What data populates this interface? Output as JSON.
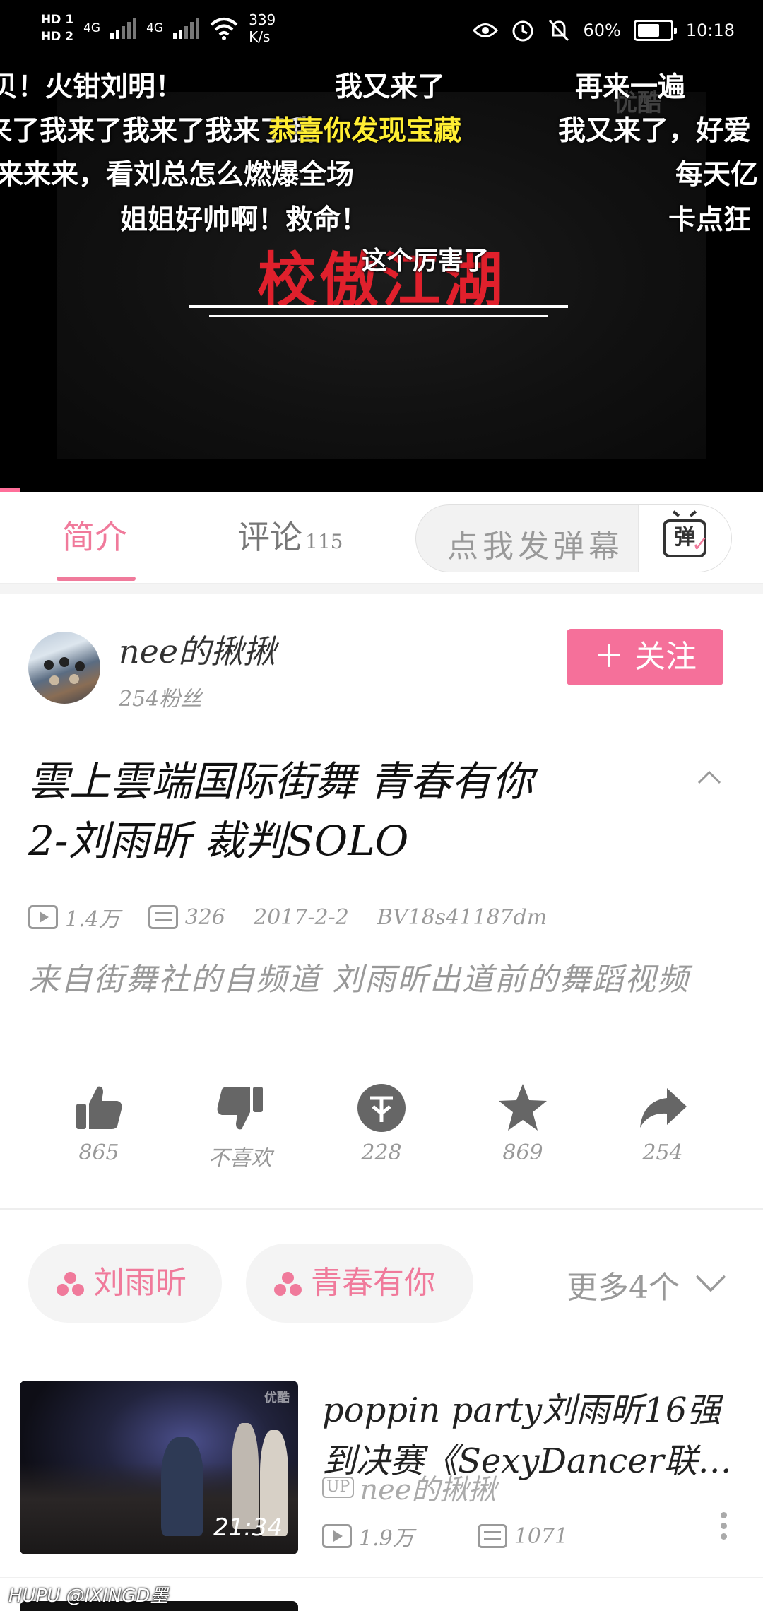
{
  "status_bar": {
    "hd1": "HD 1",
    "hd2": "HD 2",
    "net1": "4G",
    "net2": "4G",
    "net_speed": "339",
    "net_speed_unit": "K/s",
    "battery": "60%",
    "time": "10:18"
  },
  "video": {
    "watermark": "优酷",
    "title_card": "校傲江湖",
    "danmaku": [
      "贝！火钳刘明！",
      "我又来了",
      "再来一遍",
      "来了我来了我来了我来了我",
      "恭喜你发现宝藏",
      "我又来了，好爱",
      "来来来，看刘总怎么燃爆全场",
      "每天亿",
      "姐姐好帅啊！救命！",
      "卡点狂",
      "这个厉害了"
    ],
    "progress_fraction": 0.026
  },
  "tabs": {
    "intro": "简介",
    "comments": "评论",
    "comments_count": "115"
  },
  "danmu_input": {
    "placeholder": "点我发弹幕",
    "button_icon": "弹"
  },
  "uploader": {
    "name": "nee的揪揪",
    "fans": "254粉丝",
    "follow_label": "＋ 关注"
  },
  "video_info": {
    "title_line1": "雲上雲端国际街舞  青春有你",
    "title_line2": "2-刘雨昕 裁判SOLO",
    "views": "1.4万",
    "danmaku_count": "326",
    "date": "2017-2-2",
    "bvid": "BV18s41187dm",
    "description": "来自街舞社的自频道 刘雨昕出道前的舞蹈视频"
  },
  "actions": {
    "like": "865",
    "dislike": "不喜欢",
    "coin": "228",
    "favorite": "869",
    "share": "254"
  },
  "tags": {
    "tag1": "刘雨昕",
    "tag2": "青春有你",
    "more": "更多4个"
  },
  "related": [
    {
      "title": "poppin party刘雨昕16强到决赛《SexyDancer联…",
      "uploader_badge": "UP",
      "uploader": "nee的揪揪",
      "duration": "21:34",
      "views": "1.9万",
      "danmaku": "1071",
      "watermark": "优酷"
    }
  ],
  "footer_watermark": "HUPU @IXINGD墨",
  "colors": {
    "accent": "#f07a9b",
    "follow_button": "#f5709a",
    "danmaku_highlight": "#ffee33",
    "video_title_card": "#e0202c"
  }
}
